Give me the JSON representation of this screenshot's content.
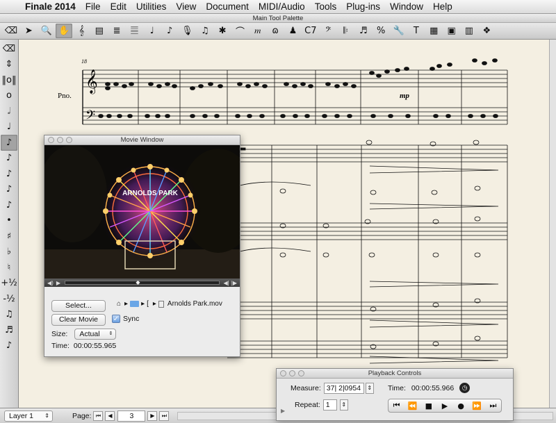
{
  "menubar": {
    "apple_icon": "apple-icon",
    "app_name": "Finale 2014",
    "items": [
      "File",
      "Edit",
      "Utilities",
      "View",
      "Document",
      "MIDI/Audio",
      "Tools",
      "Plug-ins",
      "Window",
      "Help"
    ]
  },
  "palette": {
    "title": "Main Tool Palette",
    "tools": [
      {
        "name": "eraser-icon",
        "glyph": "⌫"
      },
      {
        "name": "selection-tool-icon",
        "glyph": "➤"
      },
      {
        "name": "zoom-tool-icon",
        "glyph": "🔍"
      },
      {
        "name": "hand-grabber-icon",
        "glyph": "✋",
        "selected": true
      },
      {
        "name": "clef-tool-icon",
        "glyph": "𝄞"
      },
      {
        "name": "key-signature-icon",
        "glyph": "▤"
      },
      {
        "name": "time-signature-icon",
        "glyph": "≣"
      },
      {
        "name": "staff-tool-icon",
        "glyph": "𝄚"
      },
      {
        "name": "simple-entry-icon",
        "glyph": "♩"
      },
      {
        "name": "speedy-entry-icon",
        "glyph": "♪"
      },
      {
        "name": "hyperscribe-icon",
        "glyph": "🎙"
      },
      {
        "name": "tuplet-tool-icon",
        "glyph": "♫"
      },
      {
        "name": "special-tools-icon",
        "glyph": "✱"
      },
      {
        "name": "smart-shape-icon",
        "glyph": "⌒"
      },
      {
        "name": "expression-tool-icon",
        "glyph": "𝆐"
      },
      {
        "name": "articulation-tool-icon",
        "glyph": "ɷ"
      },
      {
        "name": "lyrics-tool-icon",
        "glyph": "♟"
      },
      {
        "name": "chord-tool-icon",
        "glyph": "C7"
      },
      {
        "name": "bass-clef-icon",
        "glyph": "𝄢"
      },
      {
        "name": "repeat-tool-icon",
        "glyph": "𝄆"
      },
      {
        "name": "measure-tool-icon",
        "glyph": "♬"
      },
      {
        "name": "resize-tool-icon",
        "glyph": "%"
      },
      {
        "name": "wrench-icon",
        "glyph": "🔧"
      },
      {
        "name": "text-tool-icon",
        "glyph": "T"
      },
      {
        "name": "graphics-tool-icon",
        "glyph": "▦"
      },
      {
        "name": "page-layout-icon",
        "glyph": "▣"
      },
      {
        "name": "mass-edit-icon",
        "glyph": "▥"
      },
      {
        "name": "palette-menu-icon",
        "glyph": "❖"
      }
    ]
  },
  "left_palette": {
    "tools": [
      {
        "name": "eraser-icon",
        "glyph": "⌫"
      },
      {
        "name": "up-down-arrow-icon",
        "glyph": "⇕"
      },
      {
        "name": "double-whole-note-icon",
        "glyph": "‖o‖"
      },
      {
        "name": "whole-note-icon",
        "glyph": "o"
      },
      {
        "name": "half-note-icon",
        "glyph": "𝅗𝅥"
      },
      {
        "name": "quarter-note-icon",
        "glyph": "♩"
      },
      {
        "name": "eighth-note-icon",
        "glyph": "♪",
        "selected": true
      },
      {
        "name": "sixteenth-note-icon",
        "glyph": "♪"
      },
      {
        "name": "thirty-second-note-icon",
        "glyph": "♪"
      },
      {
        "name": "sixty-fourth-note-icon",
        "glyph": "♪"
      },
      {
        "name": "hundred-twenty-eighth-note-icon",
        "glyph": "♪"
      },
      {
        "name": "dot-icon",
        "glyph": "•"
      },
      {
        "name": "sharp-icon",
        "glyph": "♯"
      },
      {
        "name": "flat-icon",
        "glyph": "♭"
      },
      {
        "name": "natural-icon",
        "glyph": "♮"
      },
      {
        "name": "half-step-up-icon",
        "glyph": "+½"
      },
      {
        "name": "half-step-down-icon",
        "glyph": "-½"
      },
      {
        "name": "tie-icon",
        "glyph": "♫"
      },
      {
        "name": "tuplet-icon",
        "glyph": "♬"
      },
      {
        "name": "grace-note-icon",
        "glyph": "♪"
      }
    ]
  },
  "score": {
    "measure_number": "18",
    "instrument": "Pno.",
    "dynamic": "mp"
  },
  "movie_window": {
    "title": "Movie Window",
    "sign_text": "ARNOLDS PARK",
    "select_label": "Select...",
    "clear_label": "Clear Movie",
    "sync_label": "Sync",
    "sync_checked": true,
    "size_label": "Size:",
    "size_value": "Actual",
    "time_label": "Time:",
    "time_value": "00:00:55.965",
    "file_name": "Arnolds Park.mov",
    "path_sep": "[",
    "home_icon": "home-icon",
    "folder_icon": "folder-icon",
    "file_icon": "movie-file-icon"
  },
  "playback": {
    "title": "Playback Controls",
    "measure_label": "Measure:",
    "measure_value": "37| 2|0954",
    "time_label": "Time:",
    "time_value": "00:00:55.966",
    "repeat_label": "Repeat:",
    "repeat_value": "1",
    "transport": [
      {
        "name": "rewind-to-start-icon",
        "glyph": "⏮"
      },
      {
        "name": "rewind-icon",
        "glyph": "⏪"
      },
      {
        "name": "stop-icon",
        "glyph": "■"
      },
      {
        "name": "play-icon",
        "glyph": "▶"
      },
      {
        "name": "record-icon",
        "glyph": "●"
      },
      {
        "name": "fast-forward-icon",
        "glyph": "⏩"
      },
      {
        "name": "forward-to-end-icon",
        "glyph": "⏭"
      }
    ]
  },
  "statusbar": {
    "layer_value": "Layer 1",
    "page_label": "Page:",
    "page_value": "3"
  }
}
